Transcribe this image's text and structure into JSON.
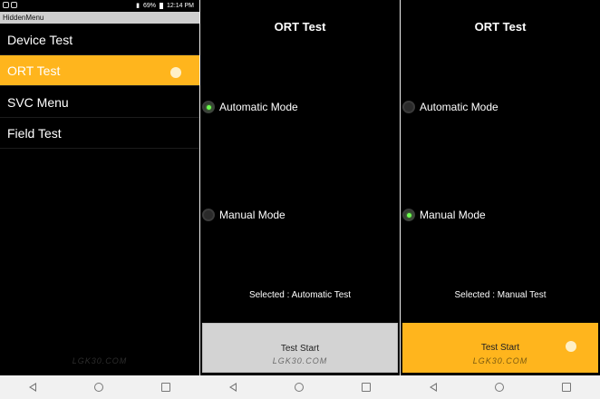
{
  "screen1": {
    "status": {
      "signal": "69%",
      "time": "12:14 PM"
    },
    "app_title": "HiddenMenu",
    "menu": [
      {
        "label": "Device Test"
      },
      {
        "label": "ORT Test"
      },
      {
        "label": "SVC Menu"
      },
      {
        "label": "Field Test"
      }
    ],
    "watermark": "LGK30.COM"
  },
  "screen2": {
    "title": "ORT Test",
    "auto_label": "Automatic Mode",
    "manual_label": "Manual Mode",
    "selected": "Selected : Automatic Test",
    "button": "Test Start",
    "watermark": "LGK30.COM"
  },
  "screen3": {
    "title": "ORT Test",
    "auto_label": "Automatic Mode",
    "manual_label": "Manual Mode",
    "selected": "Selected : Manual Test",
    "button": "Test Start",
    "watermark": "LGK30.COM"
  },
  "colors": {
    "accent": "#ffb51d",
    "radio_on": "#6cff4f",
    "button_gray": "#d3d3d3"
  },
  "icons": {
    "back": "back-triangle-icon",
    "home": "home-circle-icon",
    "recent": "recent-square-icon"
  }
}
